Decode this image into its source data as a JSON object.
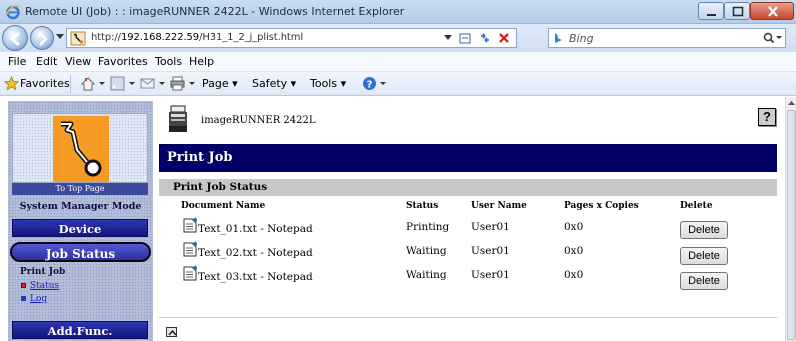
{
  "window": {
    "title": "Remote UI (Job) : : imageRUNNER 2422L - Windows Internet Explorer"
  },
  "address_bar": {
    "url_prefix": "http://",
    "url_host": "192.168.222.59",
    "url_path": "/H31_1_2_j_plist.html"
  },
  "search": {
    "placeholder": "Bing"
  },
  "menu": {
    "file": "File",
    "edit": "Edit",
    "view": "View",
    "favorites": "Favorites",
    "tools": "Tools",
    "help": "Help"
  },
  "command_bar": {
    "favorites": "Favorites",
    "page": "Page",
    "safety": "Safety",
    "tools": "Tools"
  },
  "sidebar": {
    "top_page": "To Top Page",
    "mode": "System Manager Mode",
    "device": "Device",
    "job_status": "Job Status",
    "print_job": "Print Job",
    "status": "Status",
    "log": "Log",
    "add_func": "Add.Func."
  },
  "main": {
    "printer_name": "imageRUNNER 2422L",
    "help_glyph": "?",
    "page_title": "Print Job",
    "section_title": "Print Job Status",
    "columns": [
      "Document Name",
      "Status",
      "User Name",
      "Pages x Copies",
      "Delete"
    ],
    "rows": [
      {
        "document": "Text_01.txt - Notepad",
        "status": "Printing",
        "user": "User01",
        "pages": "0x0",
        "action": "Delete"
      },
      {
        "document": "Text_02.txt - Notepad",
        "status": "Waiting",
        "user": "User01",
        "pages": "0x0",
        "action": "Delete"
      },
      {
        "document": "Text_03.txt - Notepad",
        "status": "Waiting",
        "user": "User01",
        "pages": "0x0",
        "action": "Delete"
      }
    ]
  },
  "colors": {
    "banner": "#000066",
    "nav_button": "#2f35b4",
    "section_header": "#c8c8c8",
    "sidebar_bg": "#b2bdd8"
  }
}
